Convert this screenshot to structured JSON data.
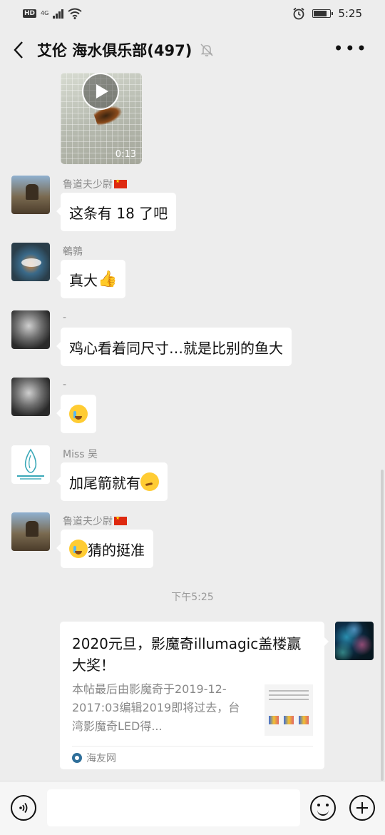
{
  "status_bar": {
    "left_badges": [
      "HD",
      "4G"
    ],
    "time": "5:25",
    "battery_level": 0.8
  },
  "header": {
    "back_icon": "chevron-left-icon",
    "title": "艾伦 海水俱乐部(497)",
    "mute_icon": "bell-off-icon",
    "more_label": "•••"
  },
  "messages": {
    "video": {
      "duration": "0:13"
    },
    "items": [
      {
        "sender": "鲁道夫少尉",
        "flag": true,
        "text": "这条有 18 了吧",
        "avatar": "soldier-avatar"
      },
      {
        "sender": "鵪鶉",
        "flag": false,
        "text": "真大",
        "emoji_after": "thumbs-up",
        "avatar": "fish-avatar"
      },
      {
        "sender": "-",
        "flag": false,
        "text": "鸡心看着同尺寸…就是比别的鱼大",
        "avatar": "child-avatar"
      },
      {
        "sender": "-",
        "flag": false,
        "text": "",
        "emoji_only": "crying-face",
        "avatar": "child-avatar"
      },
      {
        "sender": "Miss 吴",
        "flag": false,
        "text": "加尾箭就有",
        "emoji_after": "thinking-face",
        "avatar": "aquarium-logo-avatar"
      },
      {
        "sender": "鲁道夫少尉",
        "flag": true,
        "text": "猜的挺准",
        "emoji_before": "crying-face",
        "avatar": "soldier-avatar"
      }
    ],
    "timestamp": "下午5:25",
    "link_card": {
      "title": "2020元旦，影魔奇illumagic盖楼赢大奖！",
      "description": "本帖最后由影魔奇于2019-12-2017:03编辑2019即将过去，台湾影魔奇LED得...",
      "source": "海友网"
    }
  },
  "input_bar": {
    "voice_icon": "voice-icon",
    "input_value": "",
    "emoji_icon": "emoji-icon",
    "plus_icon": "plus-icon"
  }
}
